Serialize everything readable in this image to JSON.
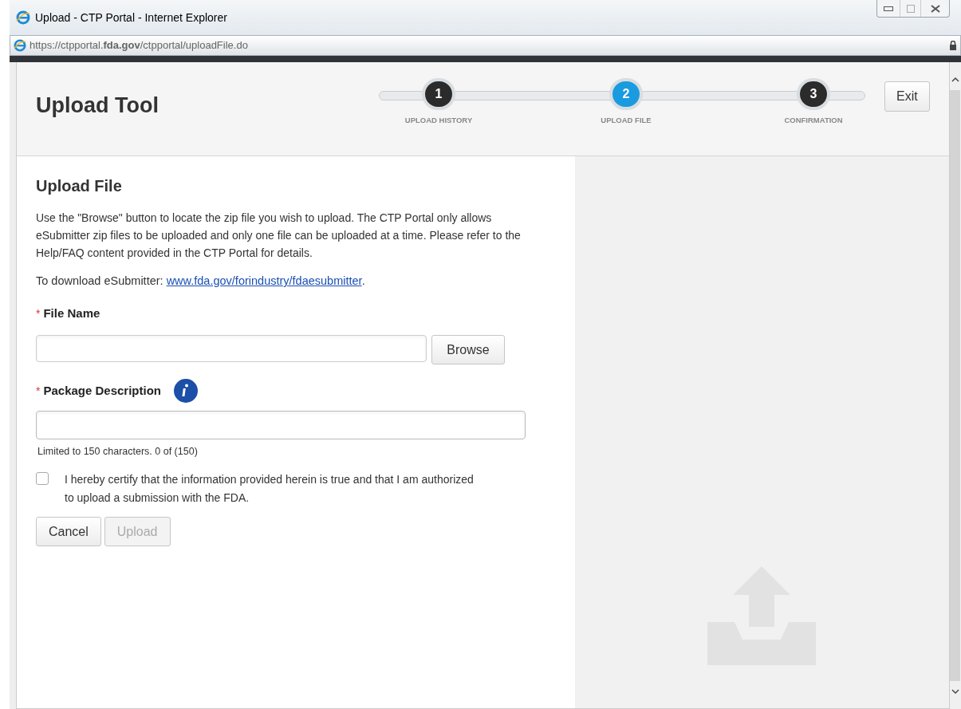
{
  "window": {
    "title": "Upload - CTP Portal - Internet Explorer"
  },
  "address_bar": {
    "url": "https://ctpportal.**fda.gov**/ctpportal/uploadFile.do"
  },
  "header": {
    "title": "Upload Tool",
    "exit_button": "Exit"
  },
  "steps": [
    {
      "number": "1",
      "label": "UPLOAD HISTORY",
      "selected": false
    },
    {
      "number": "2",
      "label": "UPLOAD FILE",
      "selected": true
    },
    {
      "number": "3",
      "label": "CONFIRMATION",
      "selected": false
    }
  ],
  "form": {
    "heading": "Upload File",
    "intro": "Use the \"Browse\" button to locate the zip file you wish to upload. The CTP Portal only allows eSubmitter zip files to be uploaded and only one file can be uploaded at a time. Please refer to the Help/FAQ content provided in the CTP Portal for details.",
    "download_text": "To download eSubmitter: ",
    "download_link": "www.fda.gov/forindustry/fdaesubmitter",
    "download_end": ".",
    "file_name": {
      "required_mark": "*",
      "label": "File Name",
      "browse_button": "Browse"
    },
    "package_description": {
      "required_mark": "*",
      "label": "Package Description",
      "hint": "Limited to 150 characters. 0 of (150)"
    },
    "certify": {
      "label": "I hereby certify that the information provided herein is true and that I am authorized to upload a submission with the FDA.",
      "checked": false
    },
    "buttons": [
      {
        "label": "Cancel",
        "disabled": false
      },
      {
        "label": "Upload",
        "disabled": true
      }
    ]
  }
}
